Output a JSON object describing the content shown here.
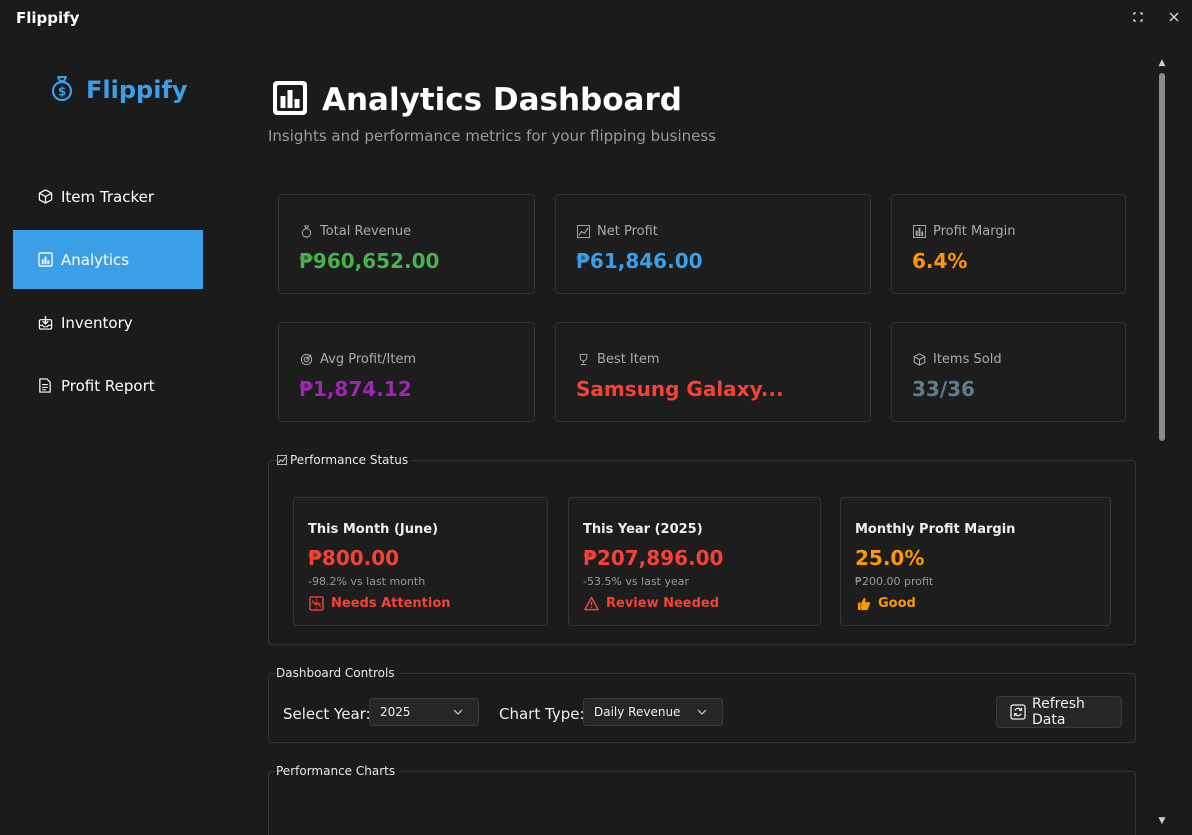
{
  "window": {
    "title": "Flippify",
    "maximize_icon": "maximize-icon",
    "close_icon": "close-icon"
  },
  "sidebar": {
    "brand": "Flippify",
    "brand_icon": "money-bag-icon",
    "items": [
      {
        "label": "Item Tracker",
        "icon": "package-icon",
        "active": false
      },
      {
        "label": "Analytics",
        "icon": "bar-chart-icon",
        "active": true
      },
      {
        "label": "Inventory",
        "icon": "inbox-icon",
        "active": false
      },
      {
        "label": "Profit Report",
        "icon": "document-icon",
        "active": false
      }
    ]
  },
  "header": {
    "title": "Analytics Dashboard",
    "title_icon": "bar-chart-icon",
    "subtitle": "Insights and performance metrics for your flipping business"
  },
  "metrics": [
    {
      "label": "Total Revenue",
      "value": "₱960,652.00",
      "icon": "money-bag-icon",
      "color": "#4caf50"
    },
    {
      "label": "Net Profit",
      "value": "₱61,846.00",
      "icon": "chart-increasing-icon",
      "color": "#3b9fe8"
    },
    {
      "label": "Profit Margin",
      "value": "6.4%",
      "icon": "bar-chart-icon",
      "color": "#ff9800"
    },
    {
      "label": "Avg Profit/Item",
      "value": "₱1,874.12",
      "icon": "target-icon",
      "color": "#9c27b0"
    },
    {
      "label": "Best Item",
      "value": "Samsung Galaxy...",
      "icon": "trophy-icon",
      "color": "#f44336"
    },
    {
      "label": "Items Sold",
      "value": "33/36",
      "icon": "package-icon",
      "color": "#607d8b"
    }
  ],
  "performance": {
    "label": "Performance Status",
    "label_icon": "chart-increasing-icon",
    "cards": [
      {
        "title": "This Month (June)",
        "value": "₱800.00",
        "sub": "-98.2% vs last month",
        "status": "Needs Attention",
        "status_icon": "chart-decreasing-icon",
        "color": "#f44336"
      },
      {
        "title": "This Year (2025)",
        "value": "₱207,896.00",
        "sub": "-53.5% vs last year",
        "status": "Review Needed",
        "status_icon": "warning-icon",
        "color": "#f44336"
      },
      {
        "title": "Monthly Profit Margin",
        "value": "25.0%",
        "sub": "₱200.00 profit",
        "status": "Good",
        "status_icon": "thumbs-up-icon",
        "color": "#ff9800"
      }
    ]
  },
  "controls": {
    "label": "Dashboard Controls",
    "year_label": "Select Year:",
    "year_value": "2025",
    "chart_type_label": "Chart Type:",
    "chart_type_value": "Daily Revenue",
    "refresh_label": "Refresh Data",
    "refresh_icon": "refresh-icon"
  },
  "charts": {
    "label": "Performance Charts"
  },
  "colors": {
    "accent": "#3b9fe8",
    "background": "#1b1b1b",
    "card_border": "#333333"
  }
}
